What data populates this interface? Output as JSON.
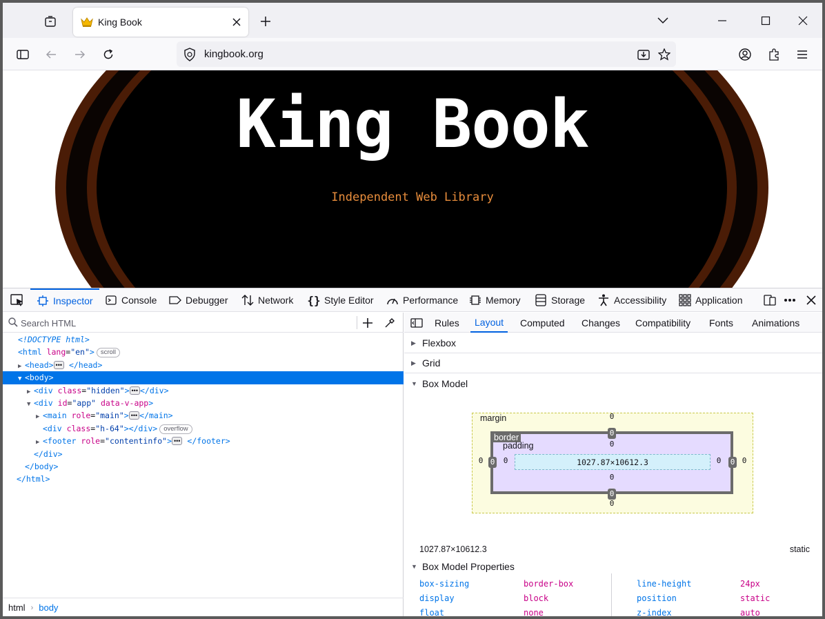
{
  "browser": {
    "tab": {
      "title": "King Book",
      "favicon": "crown-icon"
    },
    "url": "kingbook.org",
    "colors": {
      "accent": "#0061e0",
      "selection": "#0074e8"
    }
  },
  "page": {
    "title": "King Book",
    "subtitle": "Independent Web Library",
    "colors": {
      "ring": "#4a1c06",
      "background": "#000000",
      "title": "#ffffff",
      "subtitle": "#e88d3c"
    }
  },
  "devtools": {
    "tabs": [
      {
        "label": "Inspector",
        "icon": "inspector-icon"
      },
      {
        "label": "Console",
        "icon": "console-icon"
      },
      {
        "label": "Debugger",
        "icon": "debugger-icon"
      },
      {
        "label": "Network",
        "icon": "network-icon"
      },
      {
        "label": "Style Editor",
        "icon": "style-editor-icon"
      },
      {
        "label": "Performance",
        "icon": "performance-icon"
      },
      {
        "label": "Memory",
        "icon": "memory-icon"
      },
      {
        "label": "Storage",
        "icon": "storage-icon"
      },
      {
        "label": "Accessibility",
        "icon": "accessibility-icon"
      },
      {
        "label": "Application",
        "icon": "application-icon"
      }
    ],
    "search_placeholder": "Search HTML",
    "tree": {
      "doctype": "<!DOCTYPE html>",
      "html_open": "<html",
      "html_attr": "lang",
      "html_val": "\"en\"",
      "close_gt": ">",
      "scroll_badge": "scroll",
      "head_open": "<head>",
      "head_close": "</head>",
      "body_open": "<body>",
      "div_open": "<div",
      "class_attr": "class",
      "hidden_val": "\"hidden\"",
      "div_close": "</div>",
      "id_attr": "id",
      "app_val": "\"app\"",
      "datav_attr": "data-v-app",
      "main_open": "<main",
      "role_attr": "role",
      "main_val": "\"main\"",
      "main_close": "</main>",
      "h64_val": "\"h-64\"",
      "overflow_badge": "overflow",
      "footer_open": "<footer",
      "contentinfo_val": "\"contentinfo\"",
      "footer_close": "</footer>",
      "body_close": "</body>",
      "html_close": "</html>",
      "ellipsis": "•••"
    },
    "breadcrumbs": [
      "html",
      "body"
    ],
    "subtabs": [
      "Rules",
      "Layout",
      "Computed",
      "Changes",
      "Compatibility",
      "Fonts",
      "Animations"
    ],
    "sections": [
      "Flexbox",
      "Grid",
      "Box Model"
    ],
    "box_model": {
      "margin_label": "margin",
      "border_label": "border",
      "padding_label": "padding",
      "content_size": "1027.87×10612.3",
      "zero": "0"
    },
    "dimensions": "1027.87×10612.3",
    "position": "static",
    "properties_title": "Box Model Properties",
    "properties": [
      {
        "name": "box-sizing",
        "value": "border-box"
      },
      {
        "name": "display",
        "value": "block"
      },
      {
        "name": "float",
        "value": "none"
      },
      {
        "name": "line-height",
        "value": "24px"
      },
      {
        "name": "position",
        "value": "static"
      },
      {
        "name": "z-index",
        "value": "auto"
      }
    ]
  }
}
